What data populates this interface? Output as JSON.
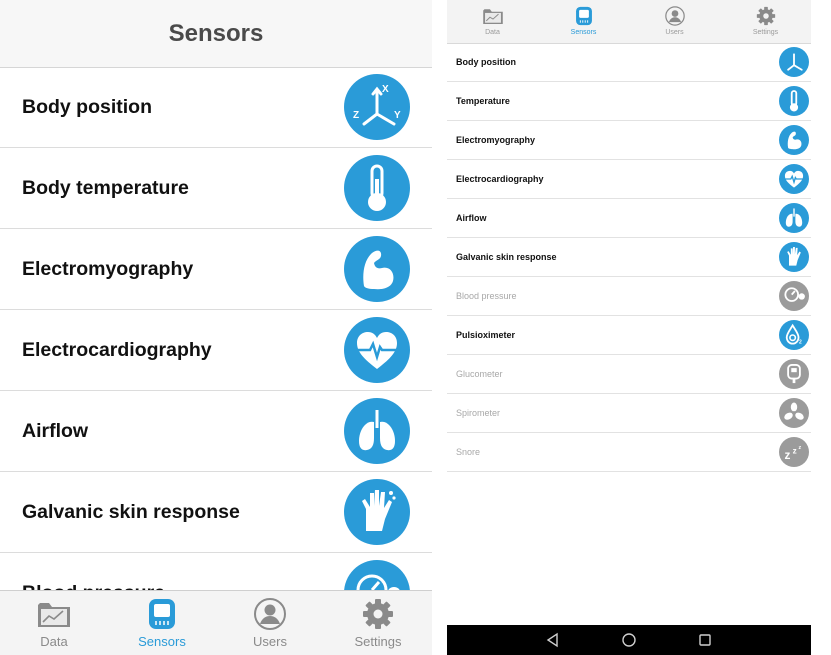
{
  "colors": {
    "accent": "#2a9bd8",
    "inactive_icon": "#9b9b9b",
    "tab_inactive": "#8a8a8a"
  },
  "ios": {
    "title": "Sensors",
    "sensors": [
      {
        "label": "Body position",
        "icon": "body-position-axes-icon"
      },
      {
        "label": "Body temperature",
        "icon": "thermometer-icon"
      },
      {
        "label": "Electromyography",
        "icon": "arm-muscle-icon"
      },
      {
        "label": "Electrocardiography",
        "icon": "heart-ecg-icon"
      },
      {
        "label": "Airflow",
        "icon": "lungs-icon"
      },
      {
        "label": "Galvanic skin response",
        "icon": "hand-icon"
      },
      {
        "label": "Blood pressure",
        "icon": "blood-pressure-gauge-icon"
      }
    ],
    "tabs": [
      {
        "label": "Data",
        "icon": "chart-folder-icon",
        "active": false
      },
      {
        "label": "Sensors",
        "icon": "sensor-chip-icon",
        "active": true
      },
      {
        "label": "Users",
        "icon": "user-icon",
        "active": false
      },
      {
        "label": "Settings",
        "icon": "gear-icon",
        "active": false
      }
    ]
  },
  "android": {
    "tabs": [
      {
        "label": "Data",
        "icon": "chart-folder-icon",
        "active": false
      },
      {
        "label": "Sensors",
        "icon": "sensor-chip-icon",
        "active": true
      },
      {
        "label": "Users",
        "icon": "user-icon",
        "active": false
      },
      {
        "label": "Settings",
        "icon": "gear-icon",
        "active": false
      }
    ],
    "sensors": [
      {
        "label": "Body position",
        "icon": "body-position-axes-icon",
        "enabled": true
      },
      {
        "label": "Temperature",
        "icon": "thermometer-icon",
        "enabled": true
      },
      {
        "label": "Electromyography",
        "icon": "arm-muscle-icon",
        "enabled": true
      },
      {
        "label": "Electrocardiography",
        "icon": "heart-ecg-icon",
        "enabled": true
      },
      {
        "label": "Airflow",
        "icon": "lungs-icon",
        "enabled": true
      },
      {
        "label": "Galvanic skin response",
        "icon": "hand-icon",
        "enabled": true
      },
      {
        "label": "Blood pressure",
        "icon": "blood-pressure-gauge-icon",
        "enabled": false
      },
      {
        "label": "Pulsioximeter",
        "icon": "pulse-oximeter-drop-icon",
        "enabled": true
      },
      {
        "label": "Glucometer",
        "icon": "glucometer-icon",
        "enabled": false
      },
      {
        "label": "Spirometer",
        "icon": "spirometer-fan-icon",
        "enabled": false
      },
      {
        "label": "Snore",
        "icon": "snore-zzz-icon",
        "enabled": false
      }
    ],
    "nav": [
      {
        "icon": "back-triangle-icon"
      },
      {
        "icon": "home-circle-icon"
      },
      {
        "icon": "recents-square-icon"
      }
    ]
  }
}
